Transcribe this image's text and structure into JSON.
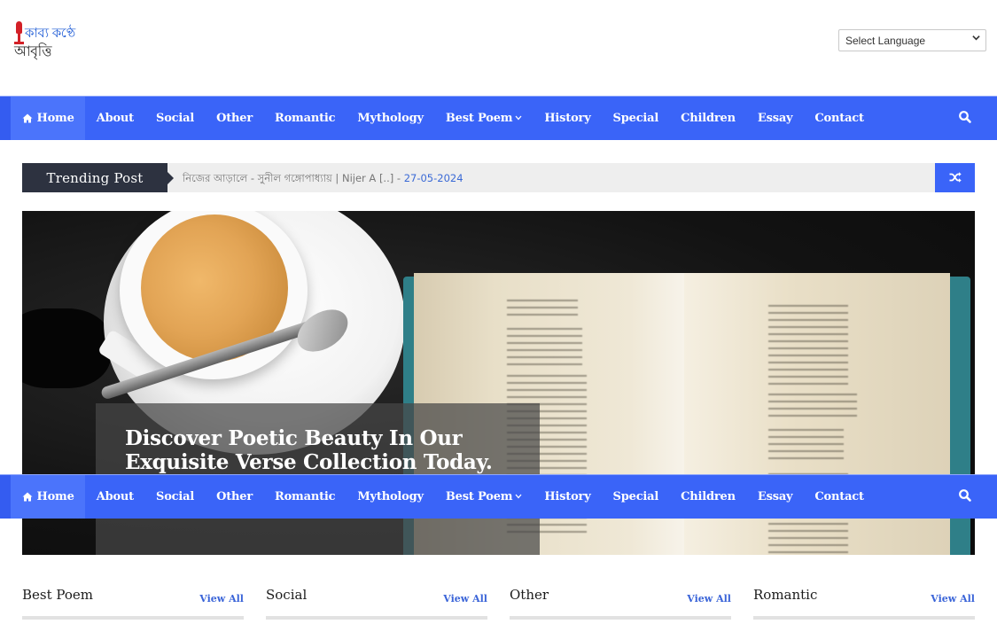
{
  "header": {
    "logo": {
      "line1": "কাব্য কণ্ঠে",
      "line2": "আবৃত্তি",
      "icon": "microphone-icon"
    },
    "language_select": {
      "selected": "Select Language",
      "icon": "chevron-down-icon"
    }
  },
  "nav": {
    "items": [
      {
        "label": "Home",
        "icon": "home-icon",
        "active": true
      },
      {
        "label": "About"
      },
      {
        "label": "Social"
      },
      {
        "label": "Other"
      },
      {
        "label": "Romantic"
      },
      {
        "label": "Mythology"
      },
      {
        "label": "Best Poem",
        "has_dropdown": true
      },
      {
        "label": "History"
      },
      {
        "label": "Special"
      },
      {
        "label": "Children"
      },
      {
        "label": "Essay"
      },
      {
        "label": "Contact"
      }
    ],
    "dropdown_caret": "⌄",
    "search_icon": "search-icon"
  },
  "trending": {
    "label": "Trending Post",
    "post_text": "নিজের আড়ালে - সুনীল গঙ্গোপাধ্যায় | Nijer A [..] - ",
    "post_date": "27-05-2024",
    "shuffle_icon": "shuffle-icon"
  },
  "hero": {
    "caption": "Discover Poetic Beauty In Our Exquisite Verse Collection Today."
  },
  "sections": [
    {
      "title": "Best Poem",
      "view_all": "View All"
    },
    {
      "title": "Social",
      "view_all": "View All"
    },
    {
      "title": "Other",
      "view_all": "View All"
    },
    {
      "title": "Romantic",
      "view_all": "View All"
    }
  ],
  "colors": {
    "nav_blue": "#3a64f8",
    "nav_active": "#4b74fb",
    "trending_dark": "#2d3240",
    "date_blue": "#3b6ad6",
    "link_blue": "#3a64d8"
  }
}
